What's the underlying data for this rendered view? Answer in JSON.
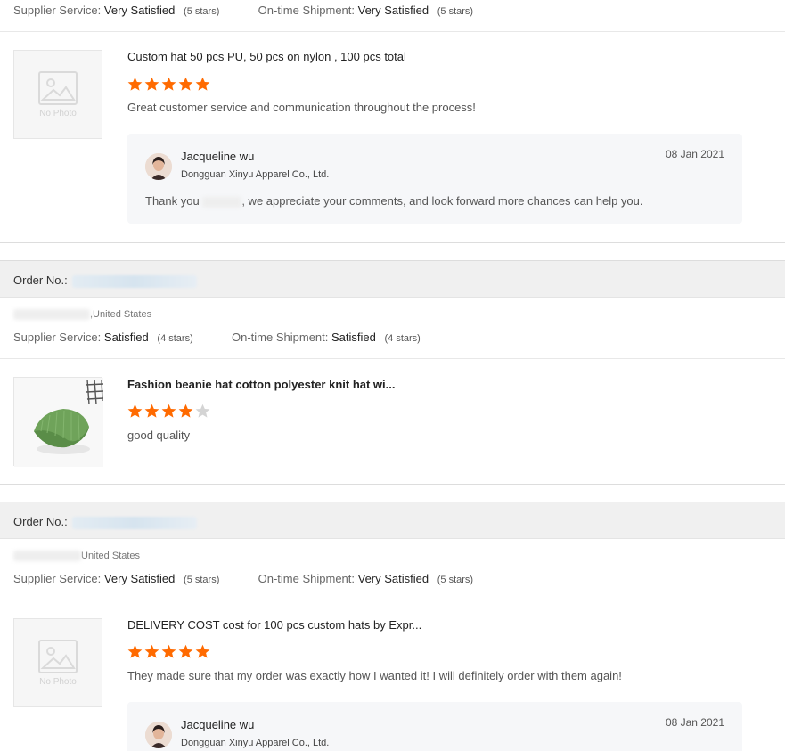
{
  "colors": {
    "star_filled": "#ff6a00",
    "star_empty": "#d4d4d4",
    "order_bar": "#f0f0f0",
    "reply_bg": "#f6f7f9"
  },
  "labels": {
    "supplier_service": "Supplier Service:",
    "on_time_shipment": "On-time Shipment:",
    "order_no": "Order No.:",
    "no_photo": "No Photo"
  },
  "reviews": [
    {
      "supplier_rating": "Very Satisfied",
      "supplier_stars": "(5 stars)",
      "shipment_rating": "Very Satisfied",
      "shipment_stars": "(5 stars)",
      "product_title": "Custom hat 50 pcs PU, 50 pcs on nylon , 100 pcs total",
      "stars": 5,
      "comment": "Great customer service and communication throughout the process!",
      "image": "no-photo",
      "reply": {
        "name": "Jacqueline wu",
        "company": "Dongguan Xinyu Apparel Co., Ltd.",
        "date": "08 Jan 2021",
        "text_before": "Thank you",
        "text_after": ", we appreciate your comments, and look forward more chances can help you."
      }
    },
    {
      "buyer_country": ",United States",
      "supplier_rating": "Satisfied",
      "supplier_stars": "(4 stars)",
      "shipment_rating": "Satisfied",
      "shipment_stars": "(4 stars)",
      "product_title": "Fashion beanie hat cotton polyester knit hat wi...",
      "stars": 4,
      "comment": "good quality",
      "image": "green-beanie-photo"
    },
    {
      "buyer_country": "United States",
      "supplier_rating": "Very Satisfied",
      "supplier_stars": "(5 stars)",
      "shipment_rating": "Very Satisfied",
      "shipment_stars": "(5 stars)",
      "product_title": "DELIVERY COST cost for 100 pcs custom hats by Expr...",
      "stars": 5,
      "comment": "They made sure that my order was exactly how I wanted it! I will definitely order with them again!",
      "image": "no-photo",
      "reply": {
        "name": "Jacqueline wu",
        "company": "Dongguan Xinyu Apparel Co., Ltd.",
        "date": "08 Jan 2021"
      }
    }
  ]
}
